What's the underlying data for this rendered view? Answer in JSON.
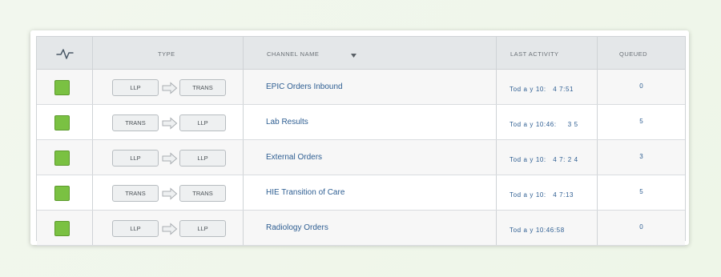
{
  "header": {
    "activity_icon": "activity-pulse-icon",
    "type": "TYPE",
    "channel_name": "CHANNEL NAME",
    "sort_icon": "caret-down-icon",
    "last_activity": "LAST ACTIVITY",
    "queued": "QUEUED"
  },
  "colors": {
    "status_green": "#7ac142",
    "link_blue": "#2e5e92"
  },
  "rows": [
    {
      "status": "green",
      "src": "LLP",
      "dst": "TRANS",
      "name": "EPIC Orders Inbound",
      "activity": "Tod a y 10:   4 7:51",
      "queued": "0"
    },
    {
      "status": "green",
      "src": "TRANS",
      "dst": "LLP",
      "name": "Lab Results",
      "activity": "Tod a y 10:46:     3 5",
      "queued": "5"
    },
    {
      "status": "green",
      "src": "LLP",
      "dst": "LLP",
      "name": "External Orders",
      "activity": "Tod a y 10:   4 7: 2 4",
      "queued": "3"
    },
    {
      "status": "green",
      "src": "TRANS",
      "dst": "TRANS",
      "name": "HIE Transition of Care",
      "activity": "Tod a y 10:   4 7:13",
      "queued": "5"
    },
    {
      "status": "green",
      "src": "LLP",
      "dst": "LLP",
      "name": "Radiology Orders",
      "activity": "Tod a y 10:46:58",
      "queued": "0"
    }
  ]
}
